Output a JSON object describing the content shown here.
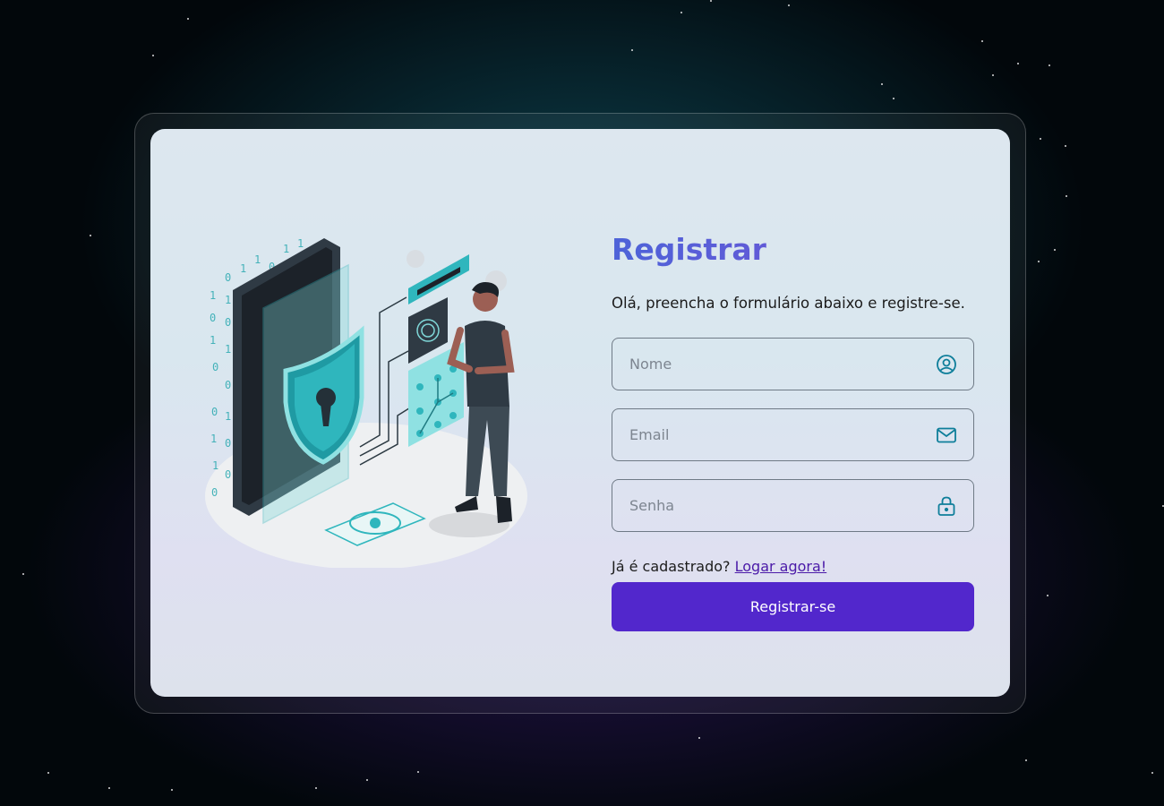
{
  "page": {
    "title": "Registrar",
    "subtitle": "Olá, preencha o formulário abaixo e registre-se."
  },
  "form": {
    "fields": [
      {
        "name": "nome",
        "placeholder": "Nome",
        "value": "",
        "icon": "user-circle-icon"
      },
      {
        "name": "email",
        "placeholder": "Email",
        "value": "",
        "icon": "envelope-icon"
      },
      {
        "name": "senha",
        "placeholder": "Senha",
        "value": "",
        "icon": "lock-icon"
      }
    ],
    "login_prompt": "Já é cadastrado?",
    "login_link": "Logar agora!",
    "submit_label": "Registrar-se"
  },
  "colors": {
    "accent": "#5227cc",
    "title_gradient_start": "#4d63d8",
    "title_gradient_end": "#7b4fd6",
    "icon": "#0e7e9a",
    "link": "#4b1aa8"
  }
}
